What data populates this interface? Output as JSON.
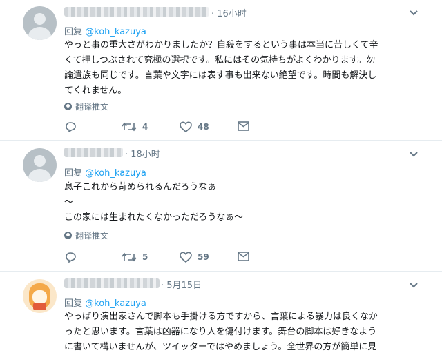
{
  "tweets": [
    {
      "timestamp": "16小时",
      "reply_prefix": "回复",
      "reply_handle": "@koh_kazuya",
      "lines": [
        "やっと事の重大さがわかりましたか？自殺をするという事は本当に苦しくて辛",
        "くて押しつぶされて究極の選択です。私にはその気持ちがよくわかります。勿",
        "論遺族も同じです。言葉や文字には表す事も出来ない絶望です。時間も解決し",
        "てくれません。"
      ],
      "translate_label": "翻译推文",
      "retweet_count": "4",
      "like_count": "48"
    },
    {
      "timestamp": "18小时",
      "reply_prefix": "回复",
      "reply_handle": "@koh_kazuya",
      "lines": [
        "息子これから苛められるんだろうなぁ",
        "～",
        "この家には生まれたくなかっただろうなぁ～"
      ],
      "translate_label": "翻译推文",
      "retweet_count": "5",
      "like_count": "59"
    },
    {
      "timestamp": "5月15日",
      "reply_prefix": "回复",
      "reply_handle": "@koh_kazuya",
      "lines": [
        "やっぱり演出家さんで脚本も手掛ける方ですから、言葉による暴力は良くなか",
        "ったと思います。言葉は凶器になり人を傷付けます。舞台の脚本は好きなよう",
        "に書いて構いませんが、ツイッターではやめましょう。全世界の方が簡単に見"
      ]
    }
  ],
  "icons": {
    "reply": "reply-icon",
    "retweet": "retweet-icon",
    "like": "heart-icon",
    "message": "message-icon",
    "more": "chevron-down-icon",
    "translate": "globe-icon"
  },
  "colors": {
    "link": "#1da1f2",
    "muted": "#657786",
    "text": "#14171a",
    "divider": "#e6ecf0"
  }
}
